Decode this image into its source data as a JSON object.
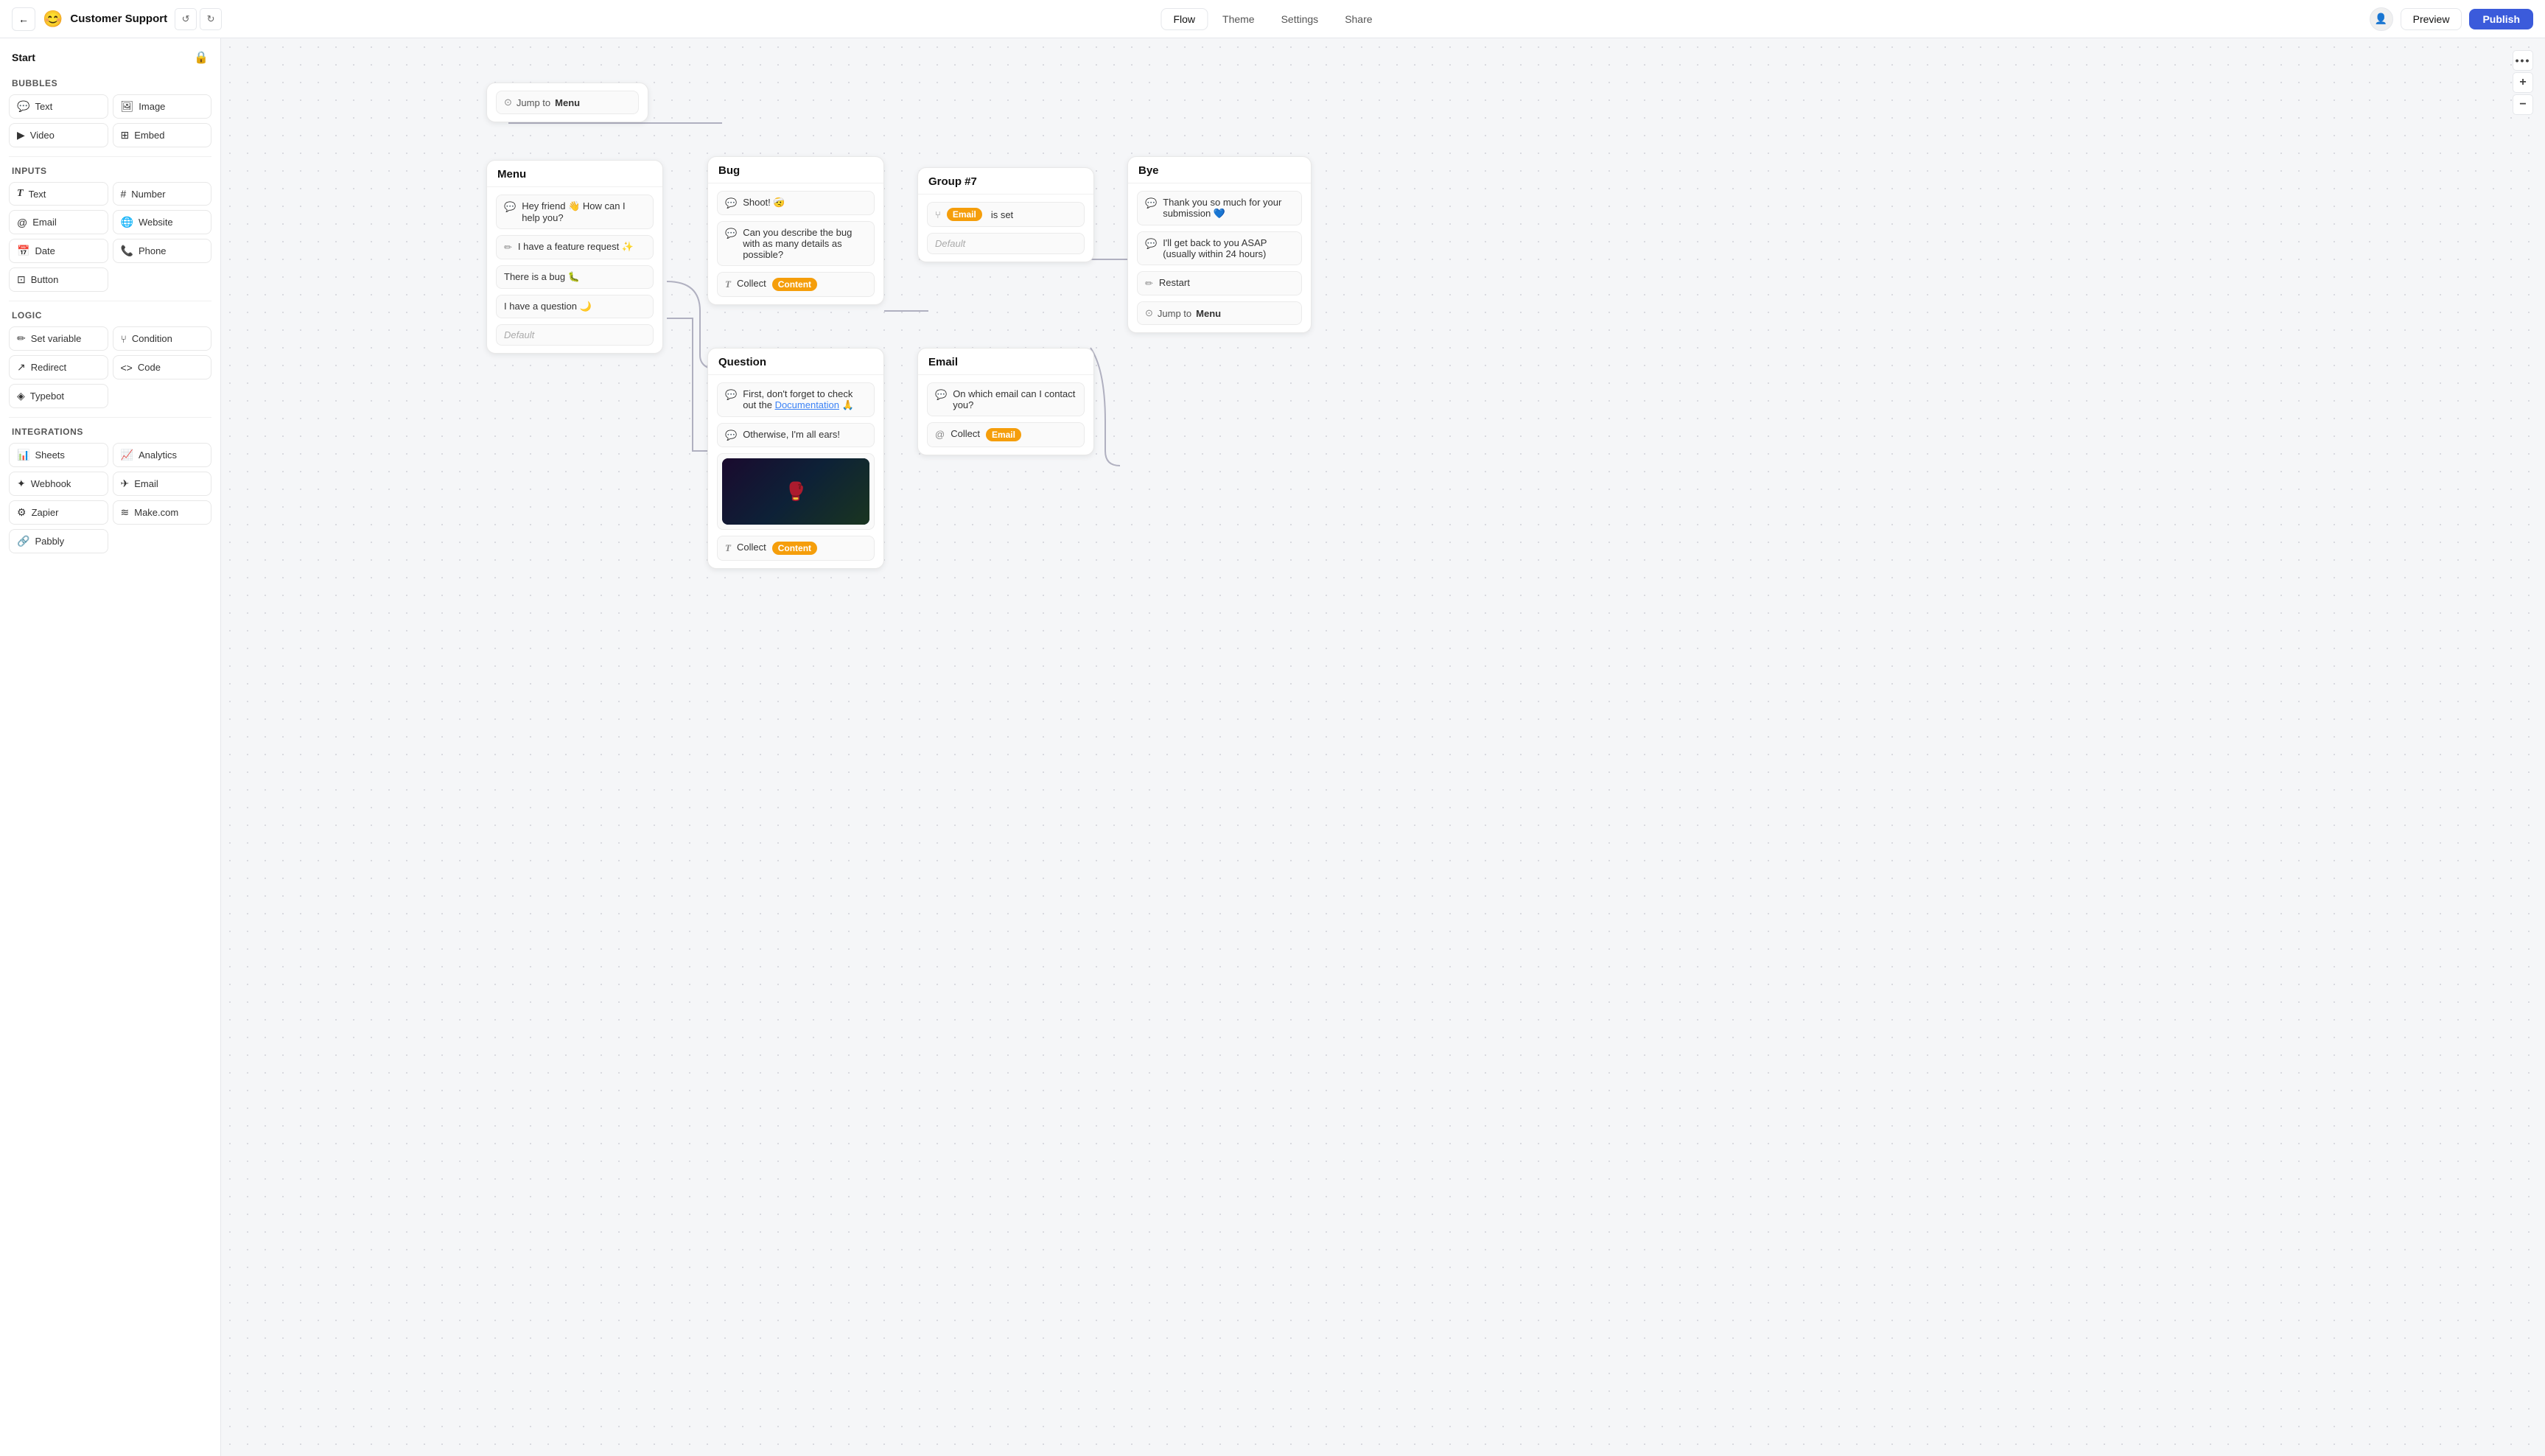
{
  "topnav": {
    "back_label": "←",
    "bot_emoji": "😊",
    "bot_name": "Customer Support",
    "undo_label": "↺",
    "redo_label": "↻",
    "tabs": [
      {
        "id": "flow",
        "label": "Flow",
        "active": true
      },
      {
        "id": "theme",
        "label": "Theme",
        "active": false
      },
      {
        "id": "settings",
        "label": "Settings",
        "active": false
      },
      {
        "id": "share",
        "label": "Share",
        "active": false
      }
    ],
    "avatar_icon": "👤",
    "preview_label": "Preview",
    "publish_label": "Publish"
  },
  "sidebar": {
    "lock_icon": "🔒",
    "start_label": "Start",
    "sections": {
      "bubbles": {
        "label": "Bubbles",
        "items": [
          {
            "id": "text",
            "icon": "💬",
            "label": "Text"
          },
          {
            "id": "image",
            "icon": "🖼",
            "label": "Image"
          },
          {
            "id": "video",
            "icon": "▶",
            "label": "Video"
          },
          {
            "id": "embed",
            "icon": "⊞",
            "label": "Embed"
          }
        ]
      },
      "inputs": {
        "label": "Inputs",
        "items": [
          {
            "id": "text-input",
            "icon": "T",
            "label": "Text"
          },
          {
            "id": "number",
            "icon": "#",
            "label": "Number"
          },
          {
            "id": "email",
            "icon": "@",
            "label": "Email"
          },
          {
            "id": "website",
            "icon": "🌐",
            "label": "Website"
          },
          {
            "id": "date",
            "icon": "📅",
            "label": "Date"
          },
          {
            "id": "phone",
            "icon": "📞",
            "label": "Phone"
          },
          {
            "id": "button",
            "icon": "⊡",
            "label": "Button"
          }
        ]
      },
      "logic": {
        "label": "Logic",
        "items": [
          {
            "id": "set-variable",
            "icon": "✏",
            "label": "Set variable"
          },
          {
            "id": "condition",
            "icon": "⑂",
            "label": "Condition"
          },
          {
            "id": "redirect",
            "icon": "↗",
            "label": "Redirect"
          },
          {
            "id": "code",
            "icon": "<>",
            "label": "Code"
          },
          {
            "id": "typebot",
            "icon": "◈",
            "label": "Typebot"
          }
        ]
      },
      "integrations": {
        "label": "Integrations",
        "items": [
          {
            "id": "sheets",
            "icon": "📊",
            "label": "Sheets"
          },
          {
            "id": "analytics",
            "icon": "📈",
            "label": "Analytics"
          },
          {
            "id": "webhook",
            "icon": "✦",
            "label": "Webhook"
          },
          {
            "id": "email-int",
            "icon": "✈",
            "label": "Email"
          },
          {
            "id": "zapier",
            "icon": "⚙",
            "label": "Zapier"
          },
          {
            "id": "makecom",
            "icon": "≋",
            "label": "Make.com"
          },
          {
            "id": "pabbly",
            "icon": "🔗",
            "label": "Pabbly"
          }
        ]
      }
    }
  },
  "nodes": {
    "menu": {
      "title": "Menu",
      "messages": [
        {
          "icon": "💬",
          "text": "Hey friend 👋 How can I help you?"
        },
        {
          "icon": "✏",
          "text": "I have a feature request ✨"
        },
        {
          "icon": "",
          "text": "There is a bug 🐛"
        },
        {
          "icon": "",
          "text": "I have a question 🌙"
        }
      ],
      "default_text": "Default"
    },
    "bug": {
      "title": "Bug",
      "messages": [
        {
          "icon": "💬",
          "text": "Shoot! 🤕"
        },
        {
          "icon": "💬",
          "text": "Can you describe the bug with as many details as possible?"
        },
        {
          "icon": "T",
          "text": "Collect",
          "tag": "Content",
          "tag_color": "orange"
        }
      ]
    },
    "group7": {
      "title": "Group #7",
      "filter_icon": "⑂",
      "tag": "Email",
      "tag_color": "orange",
      "tag_suffix": "is set",
      "default_text": "Default"
    },
    "question": {
      "title": "Question",
      "messages": [
        {
          "icon": "💬",
          "text": "First, don't forget to check out the Documentation 🙏"
        },
        {
          "icon": "💬",
          "text": "Otherwise, I'm all ears!"
        },
        {
          "icon": "🖼",
          "text": ""
        },
        {
          "icon": "T",
          "text": "Collect",
          "tag": "Content",
          "tag_color": "orange"
        }
      ]
    },
    "email": {
      "title": "Email",
      "messages": [
        {
          "icon": "💬",
          "text": "On which email can I contact you?"
        },
        {
          "icon": "@",
          "text": "Collect",
          "tag": "Email",
          "tag_color": "orange"
        }
      ]
    },
    "bye": {
      "title": "Bye",
      "messages": [
        {
          "icon": "💬",
          "text": "Thank you so much for your submission 💙"
        },
        {
          "icon": "💬",
          "text": "I'll get back to you ASAP (usually within 24 hours)"
        },
        {
          "icon": "✏",
          "text": "Restart"
        },
        {
          "icon": "⊙",
          "text": "Jump to",
          "target": "Menu"
        }
      ]
    },
    "jump_to_menu": {
      "icon": "⊙",
      "text": "Jump to",
      "target": "Menu"
    }
  },
  "zoom": {
    "more_icon": "•••",
    "plus_label": "+",
    "minus_label": "−"
  }
}
